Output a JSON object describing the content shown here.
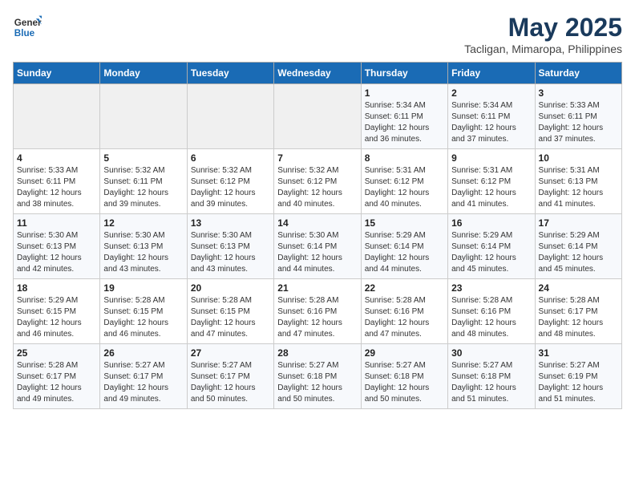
{
  "header": {
    "logo_general": "General",
    "logo_blue": "Blue",
    "title": "May 2025",
    "subtitle": "Tacligan, Mimaropa, Philippines"
  },
  "calendar": {
    "days_of_week": [
      "Sunday",
      "Monday",
      "Tuesday",
      "Wednesday",
      "Thursday",
      "Friday",
      "Saturday"
    ],
    "weeks": [
      [
        {
          "day": "",
          "info": ""
        },
        {
          "day": "",
          "info": ""
        },
        {
          "day": "",
          "info": ""
        },
        {
          "day": "",
          "info": ""
        },
        {
          "day": "1",
          "info": "Sunrise: 5:34 AM\nSunset: 6:11 PM\nDaylight: 12 hours\nand 36 minutes."
        },
        {
          "day": "2",
          "info": "Sunrise: 5:34 AM\nSunset: 6:11 PM\nDaylight: 12 hours\nand 37 minutes."
        },
        {
          "day": "3",
          "info": "Sunrise: 5:33 AM\nSunset: 6:11 PM\nDaylight: 12 hours\nand 37 minutes."
        }
      ],
      [
        {
          "day": "4",
          "info": "Sunrise: 5:33 AM\nSunset: 6:11 PM\nDaylight: 12 hours\nand 38 minutes."
        },
        {
          "day": "5",
          "info": "Sunrise: 5:32 AM\nSunset: 6:11 PM\nDaylight: 12 hours\nand 39 minutes."
        },
        {
          "day": "6",
          "info": "Sunrise: 5:32 AM\nSunset: 6:12 PM\nDaylight: 12 hours\nand 39 minutes."
        },
        {
          "day": "7",
          "info": "Sunrise: 5:32 AM\nSunset: 6:12 PM\nDaylight: 12 hours\nand 40 minutes."
        },
        {
          "day": "8",
          "info": "Sunrise: 5:31 AM\nSunset: 6:12 PM\nDaylight: 12 hours\nand 40 minutes."
        },
        {
          "day": "9",
          "info": "Sunrise: 5:31 AM\nSunset: 6:12 PM\nDaylight: 12 hours\nand 41 minutes."
        },
        {
          "day": "10",
          "info": "Sunrise: 5:31 AM\nSunset: 6:13 PM\nDaylight: 12 hours\nand 41 minutes."
        }
      ],
      [
        {
          "day": "11",
          "info": "Sunrise: 5:30 AM\nSunset: 6:13 PM\nDaylight: 12 hours\nand 42 minutes."
        },
        {
          "day": "12",
          "info": "Sunrise: 5:30 AM\nSunset: 6:13 PM\nDaylight: 12 hours\nand 43 minutes."
        },
        {
          "day": "13",
          "info": "Sunrise: 5:30 AM\nSunset: 6:13 PM\nDaylight: 12 hours\nand 43 minutes."
        },
        {
          "day": "14",
          "info": "Sunrise: 5:30 AM\nSunset: 6:14 PM\nDaylight: 12 hours\nand 44 minutes."
        },
        {
          "day": "15",
          "info": "Sunrise: 5:29 AM\nSunset: 6:14 PM\nDaylight: 12 hours\nand 44 minutes."
        },
        {
          "day": "16",
          "info": "Sunrise: 5:29 AM\nSunset: 6:14 PM\nDaylight: 12 hours\nand 45 minutes."
        },
        {
          "day": "17",
          "info": "Sunrise: 5:29 AM\nSunset: 6:14 PM\nDaylight: 12 hours\nand 45 minutes."
        }
      ],
      [
        {
          "day": "18",
          "info": "Sunrise: 5:29 AM\nSunset: 6:15 PM\nDaylight: 12 hours\nand 46 minutes."
        },
        {
          "day": "19",
          "info": "Sunrise: 5:28 AM\nSunset: 6:15 PM\nDaylight: 12 hours\nand 46 minutes."
        },
        {
          "day": "20",
          "info": "Sunrise: 5:28 AM\nSunset: 6:15 PM\nDaylight: 12 hours\nand 47 minutes."
        },
        {
          "day": "21",
          "info": "Sunrise: 5:28 AM\nSunset: 6:16 PM\nDaylight: 12 hours\nand 47 minutes."
        },
        {
          "day": "22",
          "info": "Sunrise: 5:28 AM\nSunset: 6:16 PM\nDaylight: 12 hours\nand 47 minutes."
        },
        {
          "day": "23",
          "info": "Sunrise: 5:28 AM\nSunset: 6:16 PM\nDaylight: 12 hours\nand 48 minutes."
        },
        {
          "day": "24",
          "info": "Sunrise: 5:28 AM\nSunset: 6:17 PM\nDaylight: 12 hours\nand 48 minutes."
        }
      ],
      [
        {
          "day": "25",
          "info": "Sunrise: 5:28 AM\nSunset: 6:17 PM\nDaylight: 12 hours\nand 49 minutes."
        },
        {
          "day": "26",
          "info": "Sunrise: 5:27 AM\nSunset: 6:17 PM\nDaylight: 12 hours\nand 49 minutes."
        },
        {
          "day": "27",
          "info": "Sunrise: 5:27 AM\nSunset: 6:17 PM\nDaylight: 12 hours\nand 50 minutes."
        },
        {
          "day": "28",
          "info": "Sunrise: 5:27 AM\nSunset: 6:18 PM\nDaylight: 12 hours\nand 50 minutes."
        },
        {
          "day": "29",
          "info": "Sunrise: 5:27 AM\nSunset: 6:18 PM\nDaylight: 12 hours\nand 50 minutes."
        },
        {
          "day": "30",
          "info": "Sunrise: 5:27 AM\nSunset: 6:18 PM\nDaylight: 12 hours\nand 51 minutes."
        },
        {
          "day": "31",
          "info": "Sunrise: 5:27 AM\nSunset: 6:19 PM\nDaylight: 12 hours\nand 51 minutes."
        }
      ]
    ]
  }
}
